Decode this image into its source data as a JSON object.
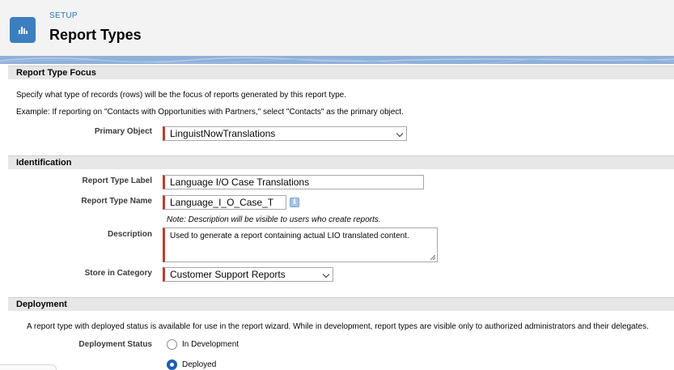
{
  "header": {
    "eyebrow": "SETUP",
    "title": "Report Types",
    "icon": "report-chart-icon",
    "accent_color": "#3c7fbf"
  },
  "focus_section": {
    "title": "Report Type Focus",
    "description": "Specify what type of records (rows) will be the focus of reports generated by this report type.",
    "example": "Example: If reporting on \"Contacts with Opportunities with Partners,\" select \"Contacts\" as the primary object.",
    "primary_object_label": "Primary Object",
    "primary_object_value": "LinguistNowTranslations"
  },
  "identification": {
    "title": "Identification",
    "label_label": "Report Type Label",
    "label_value": "Language I/O Case Translations",
    "name_label": "Report Type Name",
    "name_value": "Language_I_O_Case_T",
    "note": "Note: Description will be visible to users who create reports.",
    "description_label": "Description",
    "description_value": "Used to generate a report containing actual LIO translated content.",
    "category_label": "Store in Category",
    "category_value": "Customer Support Reports"
  },
  "deployment": {
    "title": "Deployment",
    "description": "A report type with deployed status is available for use in the report wizard. While in development, report types are visible only to authorized administrators and their delegates.",
    "status_label": "Deployment Status",
    "options": [
      "In Development",
      "Deployed"
    ],
    "selected": "Deployed"
  },
  "required_color": "#c23934"
}
